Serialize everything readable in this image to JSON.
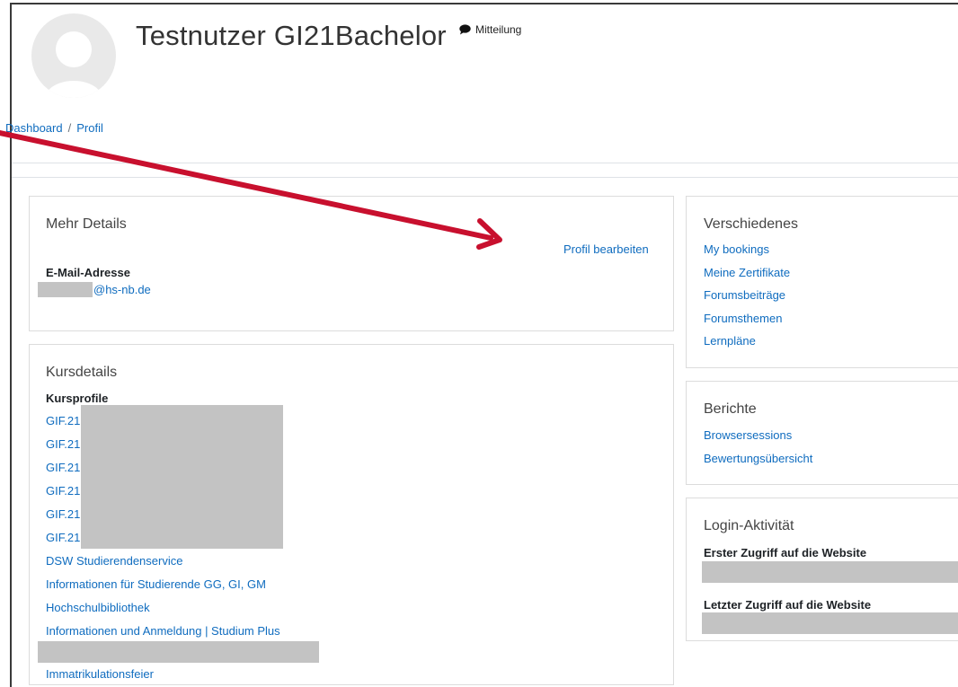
{
  "header": {
    "user_name": "Testnutzer GI21Bachelor",
    "message_label": "Mitteilung",
    "breadcrumb": {
      "dashboard": "Dashboard",
      "separator": "/",
      "profile": "Profil"
    }
  },
  "more_details": {
    "title": "Mehr Details",
    "edit_profile": "Profil bearbeiten",
    "email_label": "E-Mail-Adresse",
    "email_value": "@hs-nb.de"
  },
  "course_details": {
    "title": "Kursdetails",
    "subtitle": "Kursprofile",
    "courses": [
      "GIF.21",
      "GIF.21",
      "GIF.21",
      "GIF.21",
      "GIF.21",
      "GIF.21"
    ],
    "links": [
      "DSW Studierendenservice",
      "Informationen für Studierende GG, GI, GM",
      "Hochschulbibliothek",
      "Informationen und Anmeldung | Studium Plus"
    ],
    "partial_link": "Immatrikulationsfeier"
  },
  "misc": {
    "title": "Verschiedenes",
    "links": [
      "My bookings",
      "Meine Zertifikate",
      "Forumsbeiträge",
      "Forumsthemen",
      "Lernpläne"
    ]
  },
  "reports": {
    "title": "Berichte",
    "links": [
      "Browsersessions",
      "Bewertungsübersicht"
    ]
  },
  "login_activity": {
    "title": "Login-Aktivität",
    "first_access_label": "Erster Zugriff auf die Website",
    "last_access_label": "Letzter Zugriff auf die Website"
  },
  "colors": {
    "link": "#0f6cbf",
    "annotation_arrow": "#c8102e",
    "redaction": "#c3c3c3"
  },
  "icons": {
    "avatar": "user-avatar-icon",
    "message": "speech-bubble-icon"
  }
}
